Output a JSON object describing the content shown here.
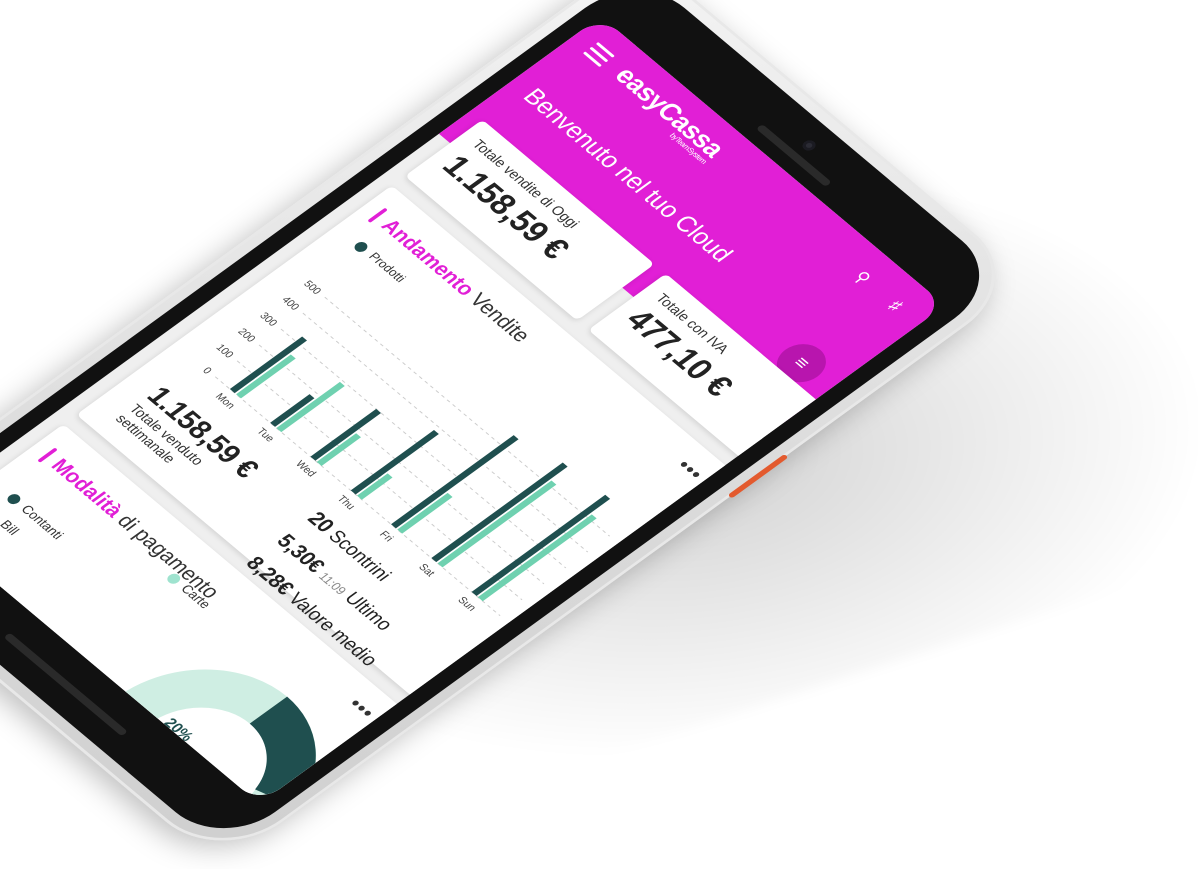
{
  "app": {
    "logo": "easyCassa",
    "logo_sub": "byTeamSystem",
    "welcome": "Benvenuto nel tuo Cloud"
  },
  "kpi": {
    "today_label": "Totale vendite di Oggi",
    "today_value": "1.158,59 €",
    "iva_label": "Totale con IVA",
    "iva_value": "477,10 €"
  },
  "sales": {
    "title_accent": "Andamento",
    "title_rest": " Vendite",
    "legend": "Prodotti",
    "menu": "•••",
    "weekly_value": "1.158,59 €",
    "weekly_label_1": "Totale venduto",
    "weekly_label_2": "settimanale",
    "receipts_value": "20",
    "receipts_label": "Scontrini",
    "last_value": "5,30€",
    "last_time": "11:09",
    "last_label": "Ultimo",
    "avg_value": "8,28€",
    "avg_label": "Valore medio"
  },
  "payments": {
    "title_accent": "Modalità",
    "title_rest": " di pagamento",
    "menu": "•••",
    "legend": [
      "Contanti",
      "Bill",
      "Carte"
    ],
    "percent_label": "20%"
  },
  "colors": {
    "magenta": "#e11fd6",
    "dark_teal": "#1f4f4f",
    "mint": "#6fd1b0",
    "light_mint": "#cfeee3"
  },
  "chart_data": {
    "type": "bar",
    "categories": [
      "Mon",
      "Tue",
      "Wed",
      "Thu",
      "Fri",
      "Sat",
      "Sun"
    ],
    "y_ticks": [
      "0",
      "100",
      "200",
      "300",
      "400",
      "500"
    ],
    "series": [
      {
        "name": "Prodotti",
        "values": [
          330,
          180,
          300,
          380,
          560,
          600,
          610
        ]
      },
      {
        "values": [
          250,
          290,
          180,
          140,
          230,
          520,
          520
        ]
      }
    ],
    "ylim": [
      0,
      650
    ],
    "grid": true
  }
}
